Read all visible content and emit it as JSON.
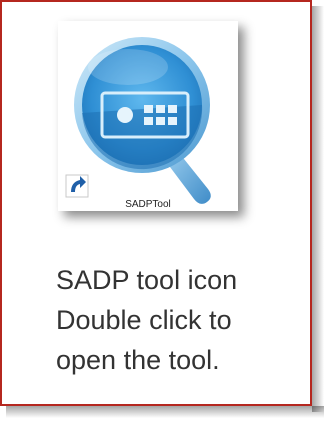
{
  "shortcut": {
    "label": "SADPTool",
    "icon": "sadp-tool-icon",
    "overlay_icon": "shortcut-arrow-icon"
  },
  "caption": {
    "line1": "SADP tool icon",
    "line2": "Double click to",
    "line3": "open the tool."
  },
  "colors": {
    "frame_border": "#b5271f",
    "icon_blue": "#3a9bdc",
    "icon_ring": "#6ab4e6"
  }
}
